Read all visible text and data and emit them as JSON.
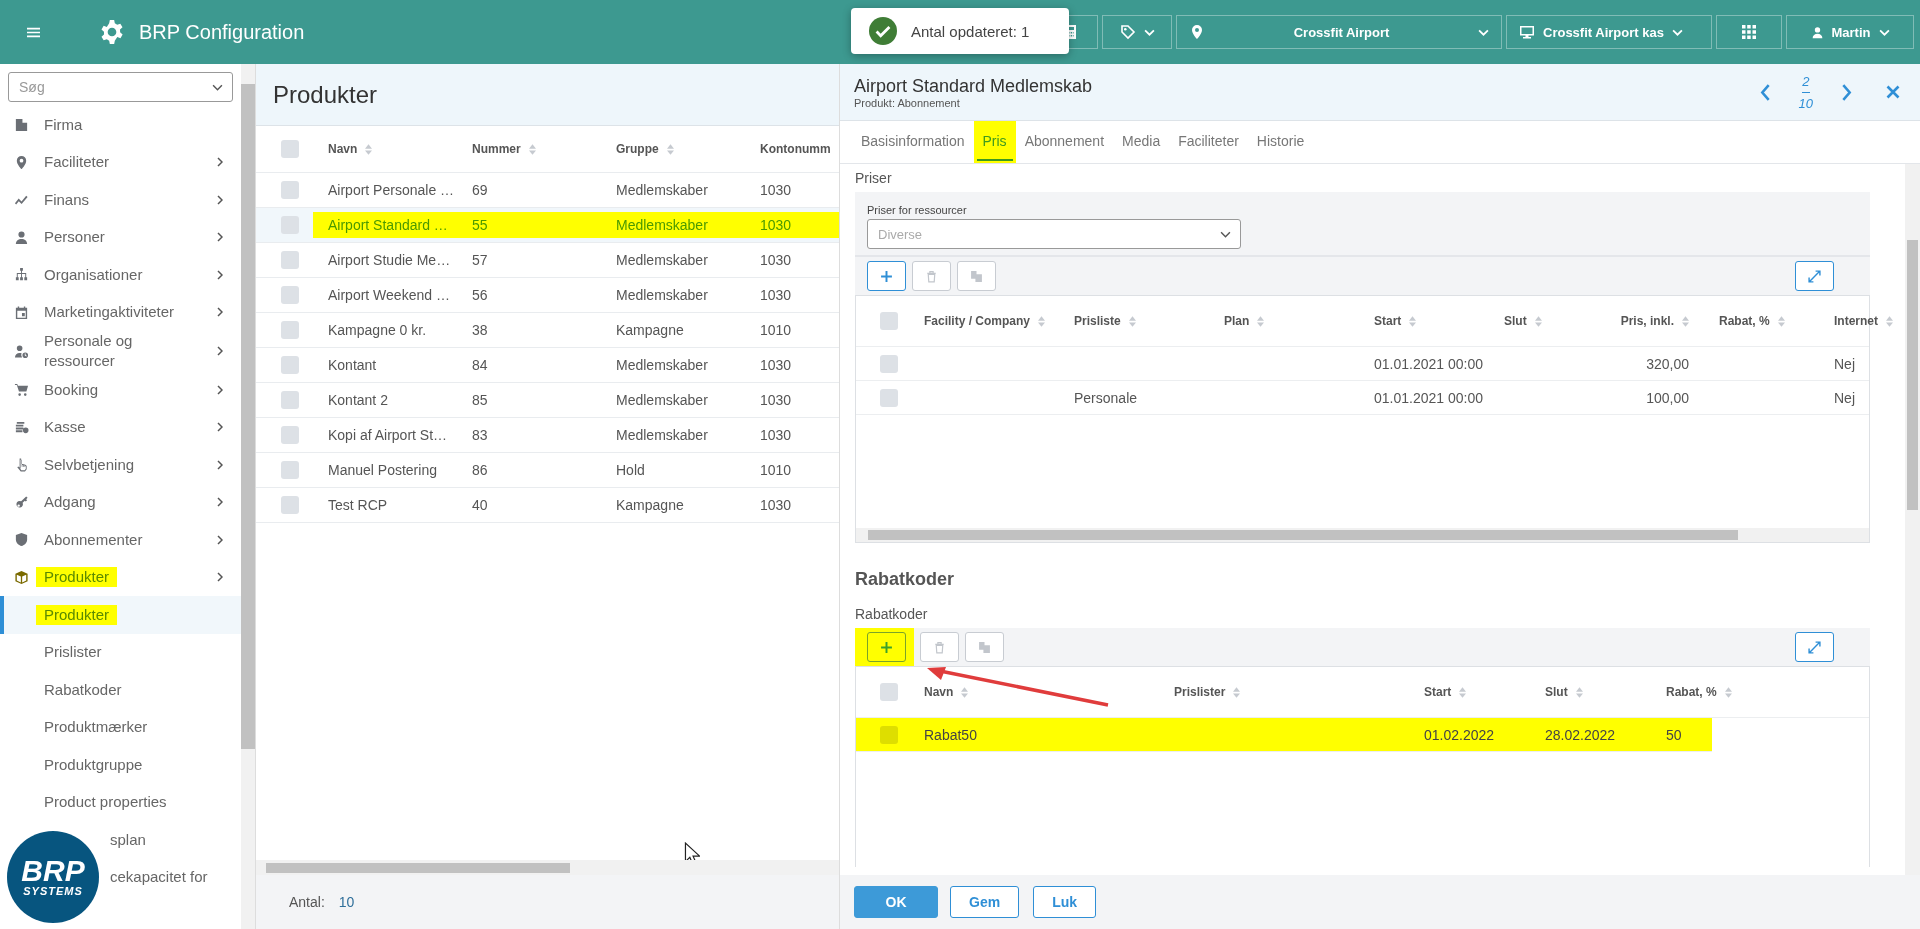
{
  "topbar": {
    "title": "BRP Configuration",
    "location": "Crossfit Airport",
    "register": "Crossfit Airport kas",
    "user": "Martin"
  },
  "toast": {
    "message": "Antal opdateret: 1"
  },
  "sidebar": {
    "search": {
      "placeholder": "Søg"
    },
    "items": [
      {
        "label": "Firma",
        "kind": "link",
        "highlighted": false
      },
      {
        "label": "Faciliteter",
        "kind": "group",
        "highlighted": false
      },
      {
        "label": "Finans",
        "kind": "group",
        "highlighted": false
      },
      {
        "label": "Personer",
        "kind": "group",
        "highlighted": false
      },
      {
        "label": "Organisationer",
        "kind": "group",
        "highlighted": false
      },
      {
        "label": "Marketingaktiviteter",
        "kind": "group",
        "highlighted": false
      },
      {
        "label": "Personale og ressourcer",
        "kind": "group",
        "highlighted": false
      },
      {
        "label": "Booking",
        "kind": "group",
        "highlighted": false
      },
      {
        "label": "Kasse",
        "kind": "group",
        "highlighted": false
      },
      {
        "label": "Selvbetjening",
        "kind": "group",
        "highlighted": false
      },
      {
        "label": "Adgang",
        "kind": "group",
        "highlighted": false
      },
      {
        "label": "Abonnementer",
        "kind": "group",
        "highlighted": false
      },
      {
        "label": "Produkter",
        "kind": "group",
        "highlighted": true,
        "children": [
          {
            "label": "Produkter",
            "selected": true,
            "highlighted": true
          },
          {
            "label": "Prislister",
            "selected": false,
            "highlighted": false
          },
          {
            "label": "Rabatkoder",
            "selected": false,
            "highlighted": false
          },
          {
            "label": "Produktmærker",
            "selected": false,
            "highlighted": false
          },
          {
            "label": "Produktgruppe",
            "selected": false,
            "highlighted": false
          },
          {
            "label": "Product properties",
            "selected": false,
            "highlighted": false
          },
          {
            "label": "splan",
            "selected": false,
            "highlighted": false
          },
          {
            "label": "cekapacitet for",
            "selected": false,
            "highlighted": false
          }
        ]
      }
    ],
    "logo": {
      "line1": "BRP",
      "line2": "SYSTEMS"
    }
  },
  "products": {
    "title": "Produkter",
    "all_checked": false,
    "columns": [
      "Navn",
      "Nummer",
      "Gruppe",
      "Kontonumm"
    ],
    "rows": [
      {
        "cells": [
          "Airport Personale …",
          "69",
          "Medlemskaber",
          "1030"
        ],
        "checked": false,
        "selected": false,
        "highlighted": false
      },
      {
        "cells": [
          "Airport Standard …",
          "55",
          "Medlemskaber",
          "1030"
        ],
        "checked": false,
        "selected": true,
        "highlighted": true
      },
      {
        "cells": [
          "Airport Studie Me…",
          "57",
          "Medlemskaber",
          "1030"
        ],
        "checked": false,
        "selected": false,
        "highlighted": false
      },
      {
        "cells": [
          "Airport Weekend …",
          "56",
          "Medlemskaber",
          "1030"
        ],
        "checked": false,
        "selected": false,
        "highlighted": false
      },
      {
        "cells": [
          "Kampagne 0 kr.",
          "38",
          "Kampagne",
          "1010"
        ],
        "checked": false,
        "selected": false,
        "highlighted": false
      },
      {
        "cells": [
          "Kontant",
          "84",
          "Medlemskaber",
          "1030"
        ],
        "checked": false,
        "selected": false,
        "highlighted": false
      },
      {
        "cells": [
          "Kontant 2",
          "85",
          "Medlemskaber",
          "1030"
        ],
        "checked": false,
        "selected": false,
        "highlighted": false
      },
      {
        "cells": [
          "Kopi af Airport St…",
          "83",
          "Medlemskaber",
          "1030"
        ],
        "checked": false,
        "selected": false,
        "highlighted": false
      },
      {
        "cells": [
          "Manuel Postering",
          "86",
          "Hold",
          "1010"
        ],
        "checked": false,
        "selected": false,
        "highlighted": false
      },
      {
        "cells": [
          "Test RCP",
          "40",
          "Kampagne",
          "1030"
        ],
        "checked": false,
        "selected": false,
        "highlighted": false
      }
    ],
    "footer": {
      "label": "Antal:",
      "value": "10"
    }
  },
  "detail": {
    "title": "Airport Standard Medlemskab",
    "subtitle": "Produkt: Abonnement",
    "pager": {
      "current": "2",
      "total": "10"
    },
    "tabs": [
      {
        "label": "Basisinformation",
        "selected": false,
        "highlighted": false
      },
      {
        "label": "Pris",
        "selected": true,
        "highlighted": true
      },
      {
        "label": "Abonnement",
        "selected": false,
        "highlighted": false
      },
      {
        "label": "Media",
        "selected": false,
        "highlighted": false
      },
      {
        "label": "Faciliteter",
        "selected": false,
        "highlighted": false
      },
      {
        "label": "Historie",
        "selected": false,
        "highlighted": false
      }
    ],
    "prices": {
      "title": "Priser",
      "filter": {
        "label": "Priser for ressourcer",
        "placeholder": "Diverse"
      },
      "toolbar": [
        {
          "kind": "add",
          "disabled": false,
          "highlighted": false
        },
        {
          "kind": "delete",
          "disabled": true,
          "highlighted": false
        },
        {
          "kind": "copy",
          "disabled": true,
          "highlighted": false
        },
        {
          "kind": "expand",
          "disabled": false,
          "highlighted": false
        }
      ],
      "all_checked": false,
      "columns": [
        "Facility / **Company**",
        "Prisliste",
        "Plan",
        "Start",
        "Slut",
        "Pris, inkl.",
        "Rabat, %",
        "Internet"
      ],
      "rows": [
        {
          "cells": [
            null,
            null,
            null,
            "01.01.2021 00:00",
            null,
            "320,00",
            null,
            "Nej"
          ],
          "checked": false
        },
        {
          "cells": [
            null,
            "Personale",
            null,
            "01.01.2021 00:00",
            null,
            "100,00",
            null,
            "Nej"
          ],
          "checked": false
        }
      ]
    },
    "discounts": {
      "heading": "Rabatkoder",
      "title": "Rabatkoder",
      "toolbar": [
        {
          "kind": "add",
          "disabled": false,
          "highlighted": true
        },
        {
          "kind": "delete",
          "disabled": true,
          "highlighted": false
        },
        {
          "kind": "copy",
          "disabled": true,
          "highlighted": false
        },
        {
          "kind": "expand",
          "disabled": false,
          "highlighted": false
        }
      ],
      "all_checked": false,
      "columns": [
        "Navn",
        "Prislister",
        "Start",
        "Slut",
        "Rabat, %"
      ],
      "rows": [
        {
          "cells": [
            "Rabat50",
            null,
            "01.02.2022",
            "28.02.2022",
            "50"
          ],
          "checked": false,
          "highlighted": true
        }
      ]
    },
    "buttons": [
      {
        "label": "OK",
        "kind": "primary"
      },
      {
        "label": "Gem",
        "kind": "secondary"
      },
      {
        "label": "Luk",
        "kind": "secondary"
      }
    ]
  }
}
